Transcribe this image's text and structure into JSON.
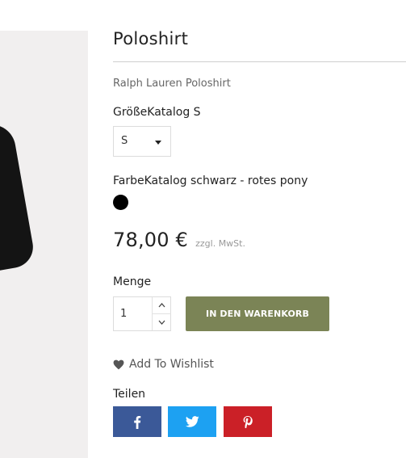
{
  "product": {
    "title": "Poloshirt",
    "subtitle": "Ralph Lauren Poloshirt"
  },
  "size": {
    "label": "GrößeKatalog S",
    "selected": "S"
  },
  "color": {
    "label": "FarbeKatalog schwarz - rotes pony",
    "swatch": "#000000"
  },
  "price": {
    "value": "78,00 €",
    "tax_note": "zzgl. MwSt."
  },
  "quantity": {
    "label": "Menge",
    "value": "1"
  },
  "cart": {
    "button_label": "IN DEN WARENKORB",
    "button_color": "#7b8456"
  },
  "wishlist": {
    "label": "Add To Wishlist",
    "icon": "heart-icon"
  },
  "share": {
    "label": "Teilen",
    "buttons": [
      {
        "network": "facebook",
        "icon": "facebook-icon",
        "color": "#3b5998"
      },
      {
        "network": "twitter",
        "icon": "twitter-icon",
        "color": "#1da1f2"
      },
      {
        "network": "pinterest",
        "icon": "pinterest-icon",
        "color": "#cb2027"
      }
    ]
  }
}
